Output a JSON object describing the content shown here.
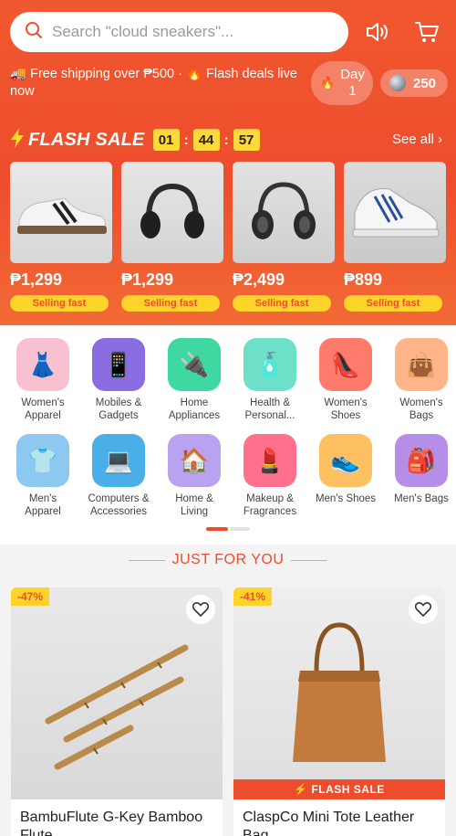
{
  "search": {
    "placeholder": "Search \"cloud sneakers\"..."
  },
  "header": {
    "notice": "🚚 Free shipping over ₱500 · 🔥 Flash deals live now",
    "day_label": "Day\n1",
    "coins": "250"
  },
  "flash_sale": {
    "title": "FLASH SALE",
    "timer": [
      "01",
      "44",
      "57"
    ],
    "see_all": "See all",
    "products": [
      {
        "name": "Sneakers",
        "price": "₱1,299",
        "tag": "Selling fast"
      },
      {
        "name": "Headphones",
        "price": "₱1,299",
        "tag": "Selling fast"
      },
      {
        "name": "Headphones",
        "price": "₱2,499",
        "tag": "Selling fast"
      },
      {
        "name": "Sneakers",
        "price": "₱899",
        "tag": "Selling fast"
      }
    ]
  },
  "categories": [
    {
      "label": "Women's\nApparel",
      "icon": "👗",
      "color": "#f9c0d0"
    },
    {
      "label": "Mobiles &\nGadgets",
      "icon": "📱",
      "color": "#8a6de0"
    },
    {
      "label": "Home\nAppliances",
      "icon": "🔌",
      "color": "#3fd8a0"
    },
    {
      "label": "Health &\nPersonal...",
      "icon": "🧴",
      "color": "#6fe0c8"
    },
    {
      "label": "Women's\nShoes",
      "icon": "👠",
      "color": "#ff7b6b"
    },
    {
      "label": "Women's\nBags",
      "icon": "👜",
      "color": "#ffb48a"
    },
    {
      "label": "Men's\nApparel",
      "icon": "👕",
      "color": "#8cc8f0"
    },
    {
      "label": "Computers &\nAccessories",
      "icon": "💻",
      "color": "#4aaee8"
    },
    {
      "label": "Home &\nLiving",
      "icon": "🏠",
      "color": "#b9a3f0"
    },
    {
      "label": "Makeup &\nFragrances",
      "icon": "💄",
      "color": "#ff6f8e"
    },
    {
      "label": "Men's Shoes",
      "icon": "👟",
      "color": "#ffc061"
    },
    {
      "label": "Men's Bags",
      "icon": "🎒",
      "color": "#b58ee8"
    }
  ],
  "just_for_you": {
    "title": "JUST FOR YOU",
    "items": [
      {
        "discount": "-47%",
        "name": "BambuFlute G-Key Bamboo Flute",
        "flash": ""
      },
      {
        "discount": "-41%",
        "name": "ClaspCo Mini Tote Leather Bag",
        "flash": "⚡ FLASH SALE"
      }
    ]
  },
  "colors": {
    "brand": "#ee4d2d",
    "accent": "#ffd42a"
  }
}
